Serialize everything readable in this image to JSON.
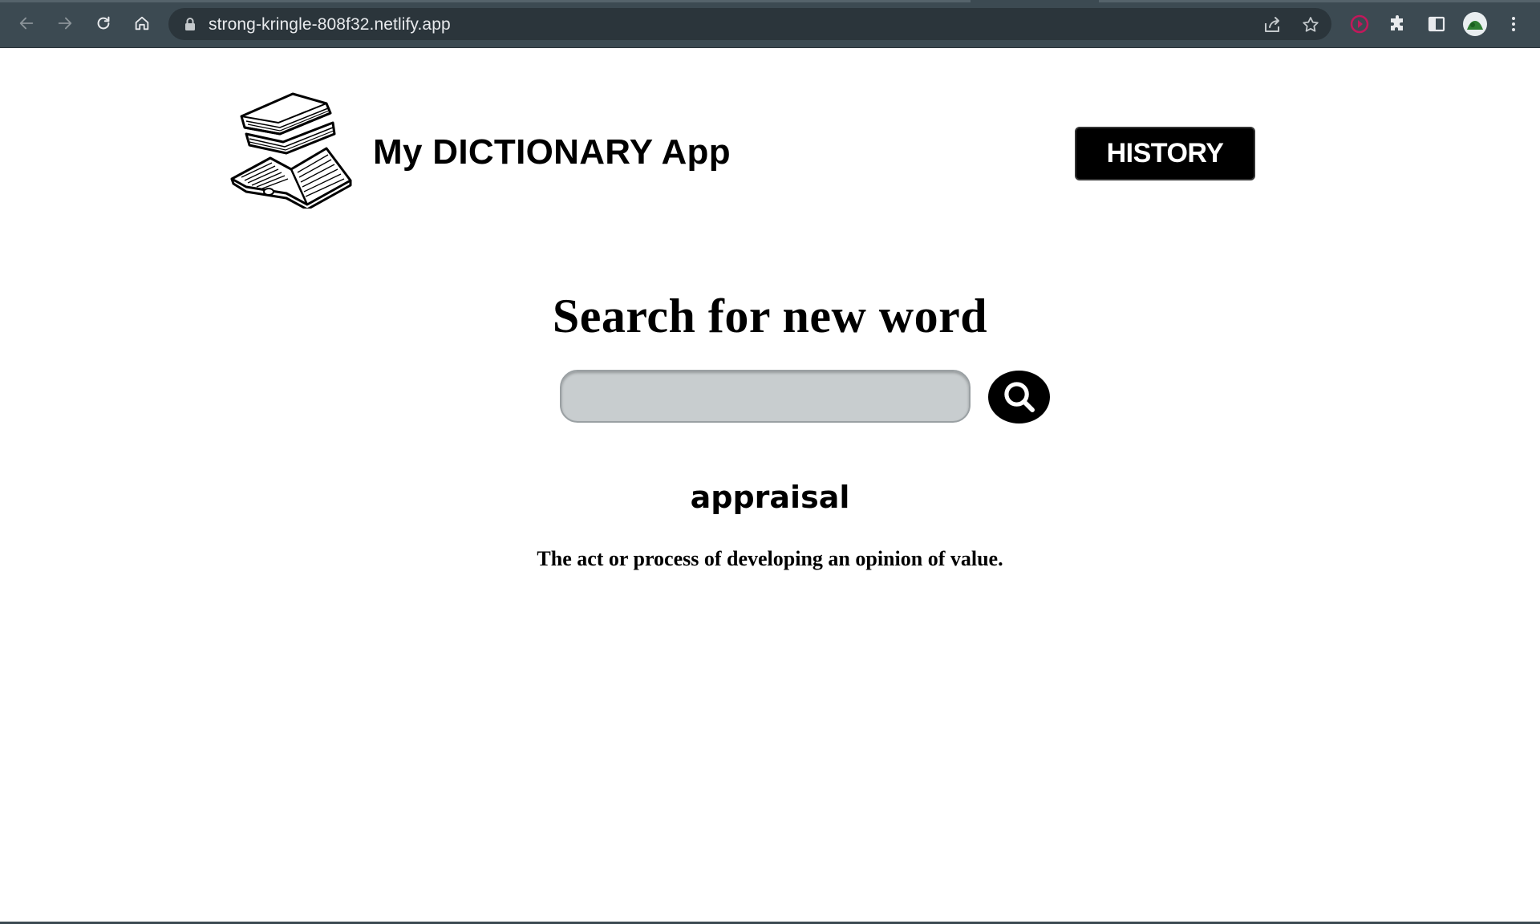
{
  "browser": {
    "url": "strong-kringle-808f32.netlify.app",
    "icons": [
      "back-icon",
      "forward-icon",
      "reload-icon",
      "home-icon",
      "lock-icon",
      "share-icon",
      "star-icon",
      "extension-red-icon",
      "puzzle-icon",
      "side-panel-icon",
      "avatar",
      "kebab-menu-icon"
    ]
  },
  "header": {
    "title": "My DICTIONARY App",
    "history_label": "HISTORY"
  },
  "search": {
    "heading": "Search for new word",
    "value": "",
    "placeholder": ""
  },
  "result": {
    "word": "appraisal",
    "definition": "The act or process of developing an opinion of value."
  },
  "colors": {
    "chrome": "#3c4a52",
    "omnibox": "#2b353b",
    "input_bg": "#c8cdcf",
    "button_bg": "#000000"
  }
}
